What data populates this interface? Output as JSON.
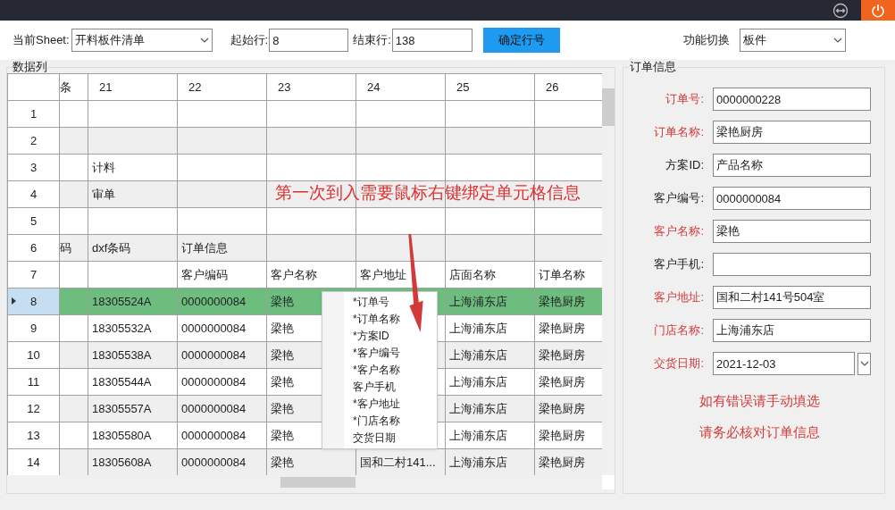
{
  "toolbar": {
    "sheet_label": "当前Sheet:",
    "sheet_value": "开料板件清单",
    "start_label": "起始行:",
    "start_value": "8",
    "end_label": "结束行:",
    "end_value": "138",
    "confirm_button": "确定行号",
    "mode_label": "功能切换",
    "mode_value": "板件"
  },
  "data_panel": {
    "title": "数据列",
    "columns": [
      "条",
      "21",
      "22",
      "23",
      "24",
      "25",
      "26"
    ],
    "rows": [
      {
        "header": "1",
        "selected": false,
        "cells": [
          "",
          "",
          "",
          "",
          "",
          "",
          ""
        ]
      },
      {
        "header": "2",
        "selected": false,
        "cells": [
          "",
          "",
          "",
          "",
          "",
          "",
          ""
        ]
      },
      {
        "header": "3",
        "selected": false,
        "cells": [
          "",
          "计料",
          "",
          "",
          "",
          "",
          ""
        ]
      },
      {
        "header": "4",
        "selected": false,
        "cells": [
          "",
          "审单",
          "",
          "",
          "",
          "",
          ""
        ]
      },
      {
        "header": "5",
        "selected": false,
        "cells": [
          "",
          "",
          "",
          "",
          "",
          "",
          ""
        ]
      },
      {
        "header": "6",
        "selected": false,
        "cells": [
          "码",
          "dxf条码",
          "订单信息",
          "",
          "",
          "",
          ""
        ]
      },
      {
        "header": "7",
        "selected": false,
        "cells": [
          "",
          "",
          "客户编码",
          "客户名称",
          "客户地址",
          "店面名称",
          "订单名称"
        ]
      },
      {
        "header": "8",
        "selected": true,
        "cells": [
          "",
          "18305524A",
          "0000000084",
          "梁艳",
          "",
          "上海浦东店",
          "梁艳厨房"
        ]
      },
      {
        "header": "9",
        "selected": false,
        "cells": [
          "",
          "18305532A",
          "0000000084",
          "梁艳",
          "",
          "上海浦东店",
          "梁艳厨房"
        ]
      },
      {
        "header": "10",
        "selected": false,
        "cells": [
          "",
          "18305538A",
          "0000000084",
          "梁艳",
          "",
          "上海浦东店",
          "梁艳厨房"
        ]
      },
      {
        "header": "11",
        "selected": false,
        "cells": [
          "",
          "18305544A",
          "0000000084",
          "梁艳",
          "",
          "上海浦东店",
          "梁艳厨房"
        ]
      },
      {
        "header": "12",
        "selected": false,
        "cells": [
          "",
          "18305557A",
          "0000000084",
          "梁艳",
          "",
          "上海浦东店",
          "梁艳厨房"
        ]
      },
      {
        "header": "13",
        "selected": false,
        "cells": [
          "",
          "18305580A",
          "0000000084",
          "梁艳",
          "",
          "上海浦东店",
          "梁艳厨房"
        ]
      },
      {
        "header": "14",
        "selected": false,
        "cells": [
          "",
          "18305608A",
          "0000000084",
          "梁艳",
          "国和二村141...",
          "上海浦东店",
          "梁艳厨房"
        ]
      }
    ]
  },
  "annotation": "第一次到入需要鼠标右键绑定单元格信息",
  "context_menu": [
    "*订单号",
    "*订单名称",
    "*方案ID",
    "*客户编号",
    "*客户名称",
    "客户手机",
    "*客户地址",
    "*门店名称",
    "交货日期"
  ],
  "order_panel": {
    "title": "订单信息",
    "fields": [
      {
        "label": "订单号:",
        "value": "0000000228",
        "required": true,
        "kind": "text"
      },
      {
        "label": "订单名称:",
        "value": "梁艳厨房",
        "required": true,
        "kind": "text"
      },
      {
        "label": "方案ID:",
        "value": "产品名称",
        "required": false,
        "kind": "text"
      },
      {
        "label": "客户编号:",
        "value": "0000000084",
        "required": false,
        "kind": "text"
      },
      {
        "label": "客户名称:",
        "value": "梁艳",
        "required": true,
        "kind": "text"
      },
      {
        "label": "客户手机:",
        "required": false,
        "kind": "text"
      },
      {
        "label": "客户地址:",
        "value": "国和二村141号504室",
        "required": true,
        "kind": "text"
      },
      {
        "label": "门店名称:",
        "value": "上海浦东店",
        "required": true,
        "kind": "text"
      },
      {
        "label": "交货日期:",
        "value": "2021-12-03",
        "required": true,
        "kind": "date"
      }
    ],
    "notes": [
      "如有错误请手动填选",
      "请务必核对订单信息"
    ]
  }
}
